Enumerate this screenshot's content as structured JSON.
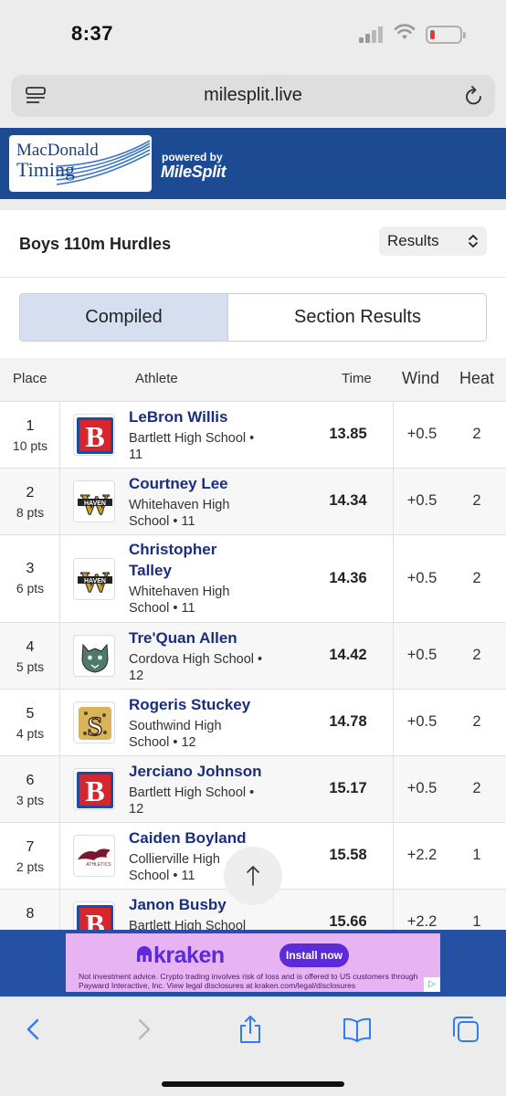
{
  "status_bar": {
    "time": "8:37"
  },
  "browser": {
    "url": "milesplit.live"
  },
  "banner": {
    "logo_line1": "MacDonald",
    "logo_line2": "Timing",
    "powered_by": "powered by",
    "brand": "MileSplit"
  },
  "event": {
    "title": "Boys 110m Hurdles",
    "view_select": "Results"
  },
  "tabs": [
    {
      "label": "Compiled",
      "active": true
    },
    {
      "label": "Section Results",
      "active": false
    }
  ],
  "table": {
    "headers": {
      "place": "Place",
      "athlete": "Athlete",
      "time": "Time",
      "wind": "Wind",
      "heat": "Heat"
    },
    "rows": [
      {
        "place": "1",
        "pts": "10 pts",
        "name": "LeBron Willis",
        "school": "Bartlett High School • 11",
        "logo": "bartlett-b-logo",
        "time": "13.85",
        "wind": "+0.5",
        "heat": "2"
      },
      {
        "place": "2",
        "pts": "8 pts",
        "name": "Courtney Lee",
        "school": "Whitehaven High School • 11",
        "logo": "whitehaven-w-logo",
        "time": "14.34",
        "wind": "+0.5",
        "heat": "2"
      },
      {
        "place": "3",
        "pts": "6 pts",
        "name": "Christopher Talley",
        "school": "Whitehaven High School • 11",
        "logo": "whitehaven-w-logo",
        "time": "14.36",
        "wind": "+0.5",
        "heat": "2"
      },
      {
        "place": "4",
        "pts": "5 pts",
        "name": "Tre'Quan Allen",
        "school": "Cordova High School • 12",
        "logo": "cordova-wildcat-logo",
        "time": "14.42",
        "wind": "+0.5",
        "heat": "2"
      },
      {
        "place": "5",
        "pts": "4 pts",
        "name": "Rogeris Stuckey",
        "school": "Southwind High School • 12",
        "logo": "southwind-s-logo",
        "time": "14.78",
        "wind": "+0.5",
        "heat": "2"
      },
      {
        "place": "6",
        "pts": "3 pts",
        "name": "Jerciano Johnson",
        "school": "Bartlett High School • 12",
        "logo": "bartlett-b-logo",
        "time": "15.17",
        "wind": "+0.5",
        "heat": "2"
      },
      {
        "place": "7",
        "pts": "2 pts",
        "name": "Caiden Boyland",
        "school": "Collierville High School • 11",
        "logo": "collierville-dragon-logo",
        "time": "15.58",
        "wind": "+2.2",
        "heat": "1"
      },
      {
        "place": "8",
        "pts": "",
        "name": "Janon Busby",
        "school": "Bartlett High School",
        "logo": "bartlett-b-logo",
        "time": "15.66",
        "wind": "+2.2",
        "heat": "1"
      }
    ]
  },
  "ad": {
    "brand": "kraken",
    "cta": "Install now",
    "fine_print": "Not investment advice. Crypto trading involves risk of loss and is offered to US customers through Payward Interactive, Inc. View legal disclosures at kraken.com/legal/disclosures"
  },
  "colors": {
    "banner_blue": "#1c4b94",
    "athlete_link": "#1a2e7e",
    "tab_active_bg": "#d6dff0",
    "ad_bg": "#e8b3f3",
    "toolbar_icon": "#2f7bf6"
  }
}
